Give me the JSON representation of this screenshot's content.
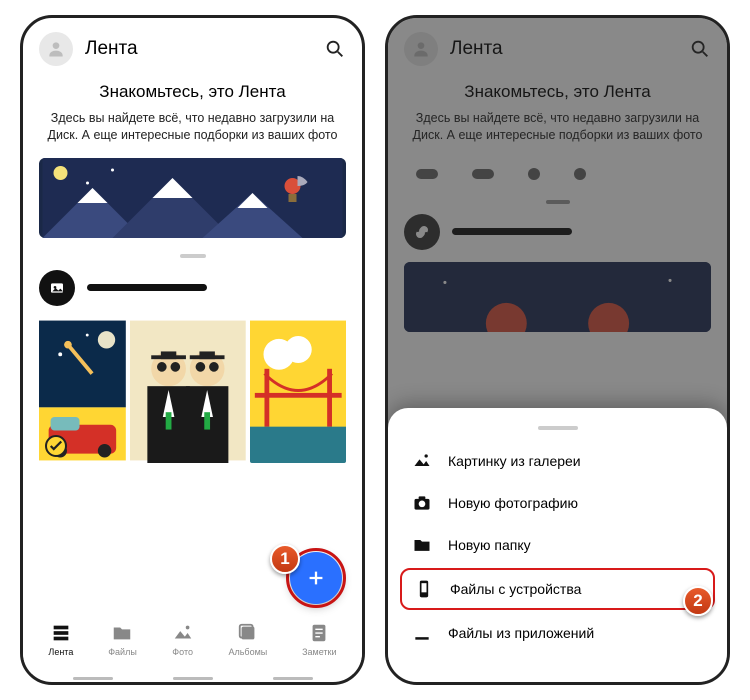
{
  "left": {
    "header": {
      "title": "Лента"
    },
    "intro": {
      "title": "Знакомьтесь, это Лента",
      "subtitle": "Здесь вы найдете всё, что недавно загрузили на Диск. А еще интересные подборки из ваших фото"
    },
    "nav": [
      {
        "key": "feed",
        "label": "Лента"
      },
      {
        "key": "files",
        "label": "Файлы"
      },
      {
        "key": "photo",
        "label": "Фото"
      },
      {
        "key": "albums",
        "label": "Альбомы"
      },
      {
        "key": "notes",
        "label": "Заметки"
      }
    ],
    "badge": "1"
  },
  "right": {
    "header": {
      "title": "Лента"
    },
    "intro": {
      "title": "Знакомьтесь, это Лента",
      "subtitle": "Здесь вы найдете всё, что недавно загрузили на Диск. А еще интересные подборки из ваших фото"
    },
    "sheet": [
      {
        "key": "gallery",
        "label": "Картинку из галереи"
      },
      {
        "key": "camera",
        "label": "Новую фотографию"
      },
      {
        "key": "folder",
        "label": "Новую папку"
      },
      {
        "key": "device",
        "label": "Файлы с устройства"
      },
      {
        "key": "apps",
        "label": "Файлы из приложений"
      }
    ],
    "badge": "2"
  }
}
